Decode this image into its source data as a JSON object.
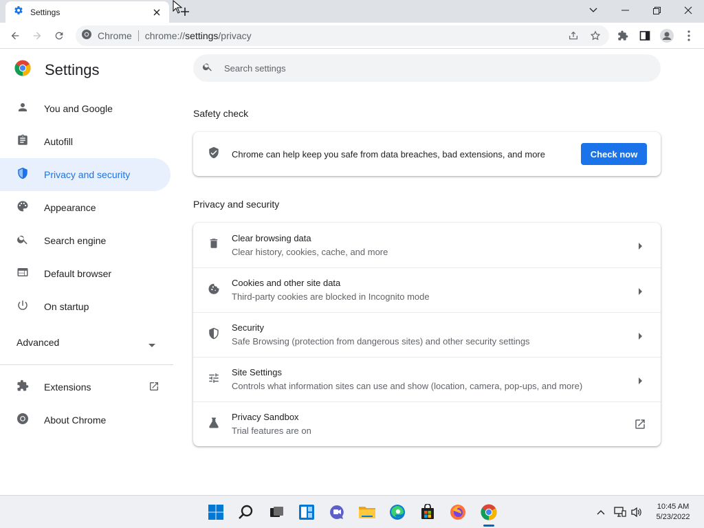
{
  "tab": {
    "title": "Settings"
  },
  "toolbar": {
    "site_label": "Chrome",
    "url_prefix": "chrome://",
    "url_host": "settings",
    "url_path": "/privacy"
  },
  "header": {
    "title": "Settings"
  },
  "search": {
    "placeholder": "Search settings"
  },
  "sidebar": {
    "items": [
      {
        "label": "You and Google"
      },
      {
        "label": "Autofill"
      },
      {
        "label": "Privacy and security"
      },
      {
        "label": "Appearance"
      },
      {
        "label": "Search engine"
      },
      {
        "label": "Default browser"
      },
      {
        "label": "On startup"
      }
    ],
    "advanced_label": "Advanced",
    "extensions_label": "Extensions",
    "about_label": "About Chrome"
  },
  "safety_check": {
    "heading": "Safety check",
    "text": "Chrome can help keep you safe from data breaches, bad extensions, and more",
    "button": "Check now"
  },
  "privacy": {
    "heading": "Privacy and security",
    "rows": [
      {
        "title": "Clear browsing data",
        "subtitle": "Clear history, cookies, cache, and more"
      },
      {
        "title": "Cookies and other site data",
        "subtitle": "Third-party cookies are blocked in Incognito mode"
      },
      {
        "title": "Security",
        "subtitle": "Safe Browsing (protection from dangerous sites) and other security settings"
      },
      {
        "title": "Site Settings",
        "subtitle": "Controls what information sites can use and show (location, camera, pop-ups, and more)"
      },
      {
        "title": "Privacy Sandbox",
        "subtitle": "Trial features are on"
      }
    ]
  },
  "taskbar": {
    "time": "10:45 AM",
    "date": "5/23/2022"
  },
  "colors": {
    "accent": "#1a73e8",
    "active_nav_bg": "#e8f0fe",
    "tab_strip": "#dee1e6"
  }
}
